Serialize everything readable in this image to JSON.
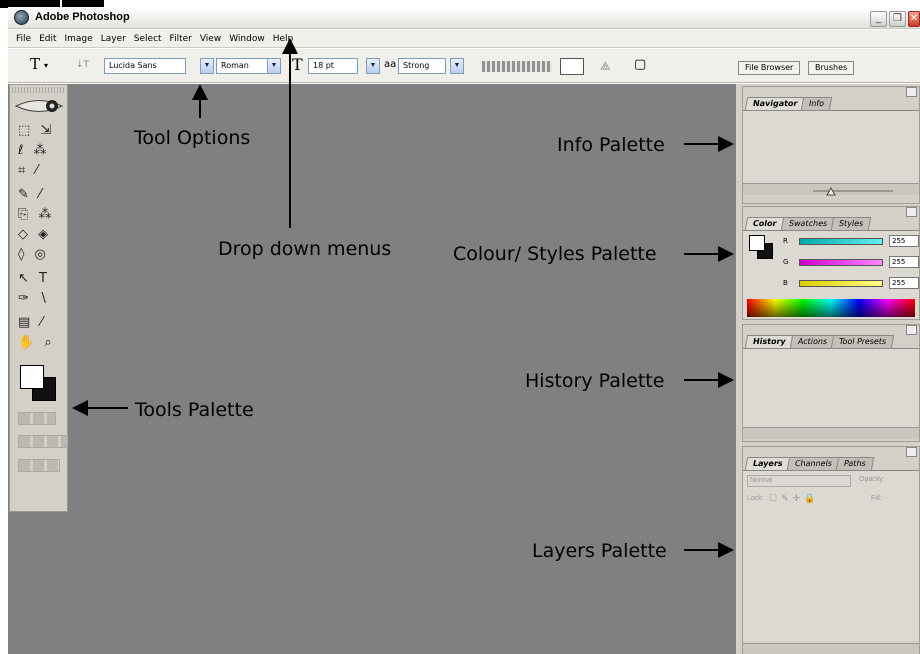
{
  "window": {
    "title": "Adobe Photoshop",
    "buttons": [
      "_",
      "❐",
      "✕"
    ]
  },
  "menubar": [
    "File",
    "Edit",
    "Image",
    "Layer",
    "Select",
    "Filter",
    "View",
    "Window",
    "Help"
  ],
  "options": {
    "tool_glyph": "T",
    "orient_glyph": "↓T",
    "font_family": "Lucida Sans",
    "font_style": "Roman",
    "size_glyph": "T",
    "font_size": "18 pt",
    "aa_glyph": "aa",
    "antialias": "Strong",
    "warp_glyph": "⟁",
    "palette_glyph": "▢"
  },
  "palette_well": {
    "tabs": [
      "File Browser",
      "Brushes"
    ]
  },
  "tools": {
    "rows": [
      "⬚ ⇲",
      "ℓ ⁂",
      "⌗ ⁄",
      "✎ ⁄",
      "⎘ ⁂",
      "◇ ◈",
      "◊ ◎",
      "↖ T",
      "✑ ∖",
      "▤ ⁄",
      "✋ ⌕"
    ]
  },
  "navigator_palette": {
    "tabs": [
      "Navigator",
      "Info"
    ]
  },
  "color_palette": {
    "tabs": [
      "Color",
      "Swatches",
      "Styles"
    ],
    "channels": [
      {
        "label": "R",
        "value": "255",
        "color": "#30c0c8"
      },
      {
        "label": "G",
        "value": "255",
        "color": "#d030c8"
      },
      {
        "label": "B",
        "value": "255",
        "color": "#e0d020"
      }
    ]
  },
  "history_palette": {
    "tabs": [
      "History",
      "Actions",
      "Tool Presets"
    ]
  },
  "layers_palette": {
    "tabs": [
      "Layers",
      "Channels",
      "Paths"
    ],
    "blend_mode": "Normal",
    "opacity_label": "Opacity:",
    "lock_label": "Lock:",
    "fill_label": "Fill:"
  },
  "annotations": {
    "tool_options": "Tool Options",
    "drop_down_menus": "Drop down menus",
    "tools_palette": "Tools Palette",
    "info_palette": "Info Palette",
    "colour_styles_palette": "Colour/ Styles Palette",
    "history_palette": "History Palette",
    "layers_palette": "Layers Palette"
  }
}
